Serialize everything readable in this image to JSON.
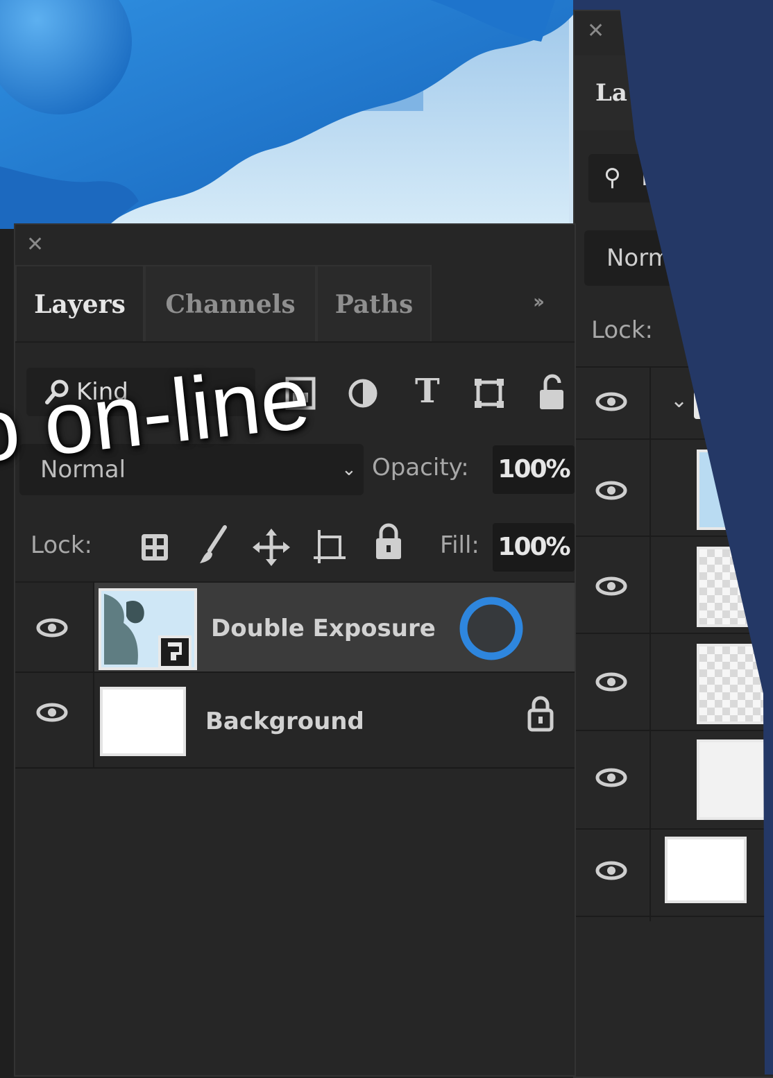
{
  "left_panel": {
    "close_icon": "close-icon",
    "tabs": [
      {
        "label": "Layers",
        "active": true
      },
      {
        "label": "Channels",
        "active": false
      },
      {
        "label": "Paths",
        "active": false
      }
    ],
    "more_icon": "double-chevron-right-icon",
    "filter": {
      "kind_label": "Kind",
      "kind_icon": "search-icon",
      "filter_icons": [
        "image-filter-icon",
        "adjustment-filter-icon",
        "type-filter-icon",
        "shape-filter-icon",
        "smart-object-filter-icon"
      ]
    },
    "blend_mode": "Normal",
    "opacity_label": "Opacity:",
    "opacity_value": "100%",
    "lock_label": "Lock:",
    "lock_icons": [
      "lock-transparent-pixels-icon",
      "lock-image-pixels-icon",
      "lock-position-icon",
      "lock-artboard-icon",
      "lock-all-icon"
    ],
    "fill_label": "Fill:",
    "fill_value": "100%",
    "layers": [
      {
        "name": "Double Exposure",
        "selected": true,
        "smart_object": true,
        "visible": true
      },
      {
        "name": "Background",
        "selected": false,
        "locked": true,
        "visible": true
      }
    ]
  },
  "right_panel": {
    "tab_partial": "La",
    "kind_partial": "K",
    "blend_partial": "Norm",
    "lock_label": "Lock:"
  },
  "caption": "o on-line",
  "colors": {
    "panel_bg": "#262626",
    "selected_row": "#3b3b3b",
    "accent_ring": "#2e86de",
    "navy_overlay": "#243866"
  }
}
